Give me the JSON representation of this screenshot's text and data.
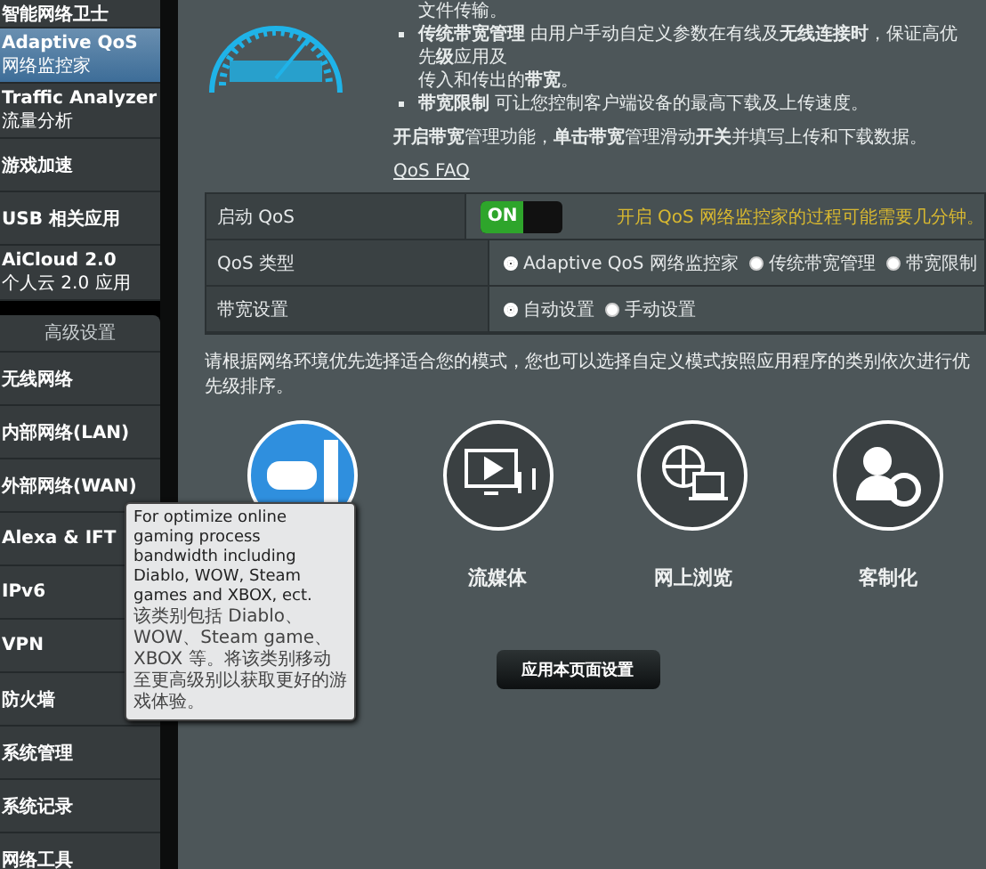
{
  "sidebar": {
    "items": [
      {
        "label": "智能网络卫士",
        "selected": false
      },
      {
        "label": "Adaptive QoS",
        "sublabel": "网络监控家",
        "selected": true
      },
      {
        "label": "Traffic Analyzer",
        "sublabel": "流量分析",
        "selected": false
      },
      {
        "label": "游戏加速",
        "selected": false
      },
      {
        "label": "USB 相关应用",
        "selected": false
      },
      {
        "label": "AiCloud 2.0",
        "sublabel": "个人云 2.0 应用",
        "selected": false
      }
    ],
    "section": "高级设置",
    "advanced_items": [
      {
        "label": "无线网络",
        "selected": false
      },
      {
        "label": "内部网络(LAN)",
        "selected": false
      },
      {
        "label": "外部网络(WAN)",
        "selected": false
      },
      {
        "label": "Alexa & IFT",
        "selected": false
      },
      {
        "label": "IPv6",
        "selected": false
      },
      {
        "label": "VPN",
        "selected": false
      },
      {
        "label": "防火墙",
        "selected": false
      },
      {
        "label": "系统管理",
        "selected": false
      },
      {
        "label": "系统记录",
        "selected": false
      },
      {
        "label": "网络工具",
        "selected": false
      }
    ]
  },
  "intro": {
    "lines": [
      {
        "kind": "continuation",
        "text": "文件传输。"
      },
      {
        "kind": "bullet",
        "text": "**传统带宽管理** 由用户手动自定义参数在有线及**无线连接时**，保证高优先**级**应用及"
      },
      {
        "kind": "continuation",
        "text": "传入和传出的**带宽**。"
      },
      {
        "kind": "bullet",
        "text": "**带宽限制** 可让您控制客户端设备的最高下载及上传速度。"
      }
    ],
    "note": "**开启带宽**管理功能，**单击带宽**管理滑动**开关**并填写上传和下载数据。",
    "faq_link": "QoS FAQ"
  },
  "settings": [
    {
      "kind": "toggle",
      "label": "启动 QoS",
      "toggle": {
        "label": "ON",
        "on": true
      },
      "hint": "开启 QoS 网络监控家的过程可能需要几分钟。"
    },
    {
      "kind": "radio",
      "label": "QoS 类型",
      "options": [
        {
          "label": "Adaptive QoS 网络监控家",
          "selected": true
        },
        {
          "label": "传统带宽管理",
          "selected": false
        },
        {
          "label": "带宽限制",
          "selected": false
        }
      ]
    },
    {
      "kind": "radio",
      "label": "带宽设置",
      "options": [
        {
          "label": "自动设置",
          "selected": true
        },
        {
          "label": "手动设置",
          "selected": false
        }
      ]
    }
  ],
  "instruction": "请根据网络环境优先选择适合您的模式，您也可以选择自定义模式按照应用程序的类别依次进行优先级排序。",
  "categories": [
    {
      "kind": "game",
      "selected": true
    },
    {
      "kind": "streaming",
      "label": "流媒体",
      "selected": false
    },
    {
      "kind": "browsing",
      "label": "网上浏览",
      "selected": false
    },
    {
      "kind": "custom",
      "label": "客制化",
      "selected": false
    }
  ],
  "tooltip": {
    "english": "For optimize online gaming process bandwidth including Diablo, WOW, Steam games and XBOX, ect.",
    "chinese": "该类别包括 Diablo、 WOW、Steam game、 XBOX 等。将该类别移动至更高级别以获取更好的游戏体验。"
  },
  "apply_button": "应用本页面设置"
}
